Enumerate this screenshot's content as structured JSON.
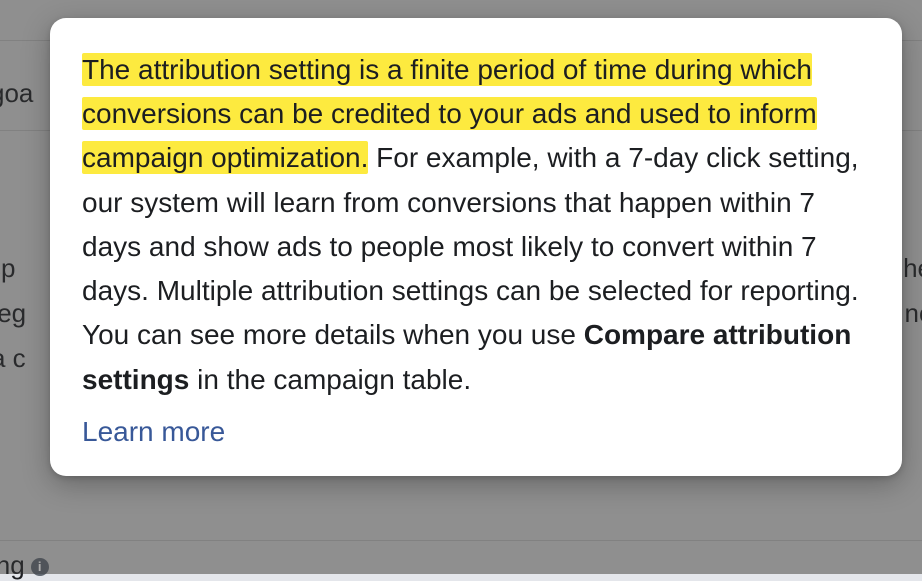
{
  "background": {
    "goa": "goa",
    "sp": " sp",
    "teg": "teg",
    "ac": "  a c",
    "ing": "ing",
    "he": "he",
    "nc": "nc"
  },
  "tooltip": {
    "highlighted_text": "The attribution setting is a finite period of time during which conversions can be credited to your ads and used to inform campaign optimization.",
    "body_text": " For example, with a 7-day click setting, our system will learn from conversions that happen within 7 days and show ads to people most likely to convert within 7 days. Multiple attribution settings can be selected for reporting. You can see more details when you use ",
    "bold_text": "Compare attribution settings",
    "body_tail": " in the campaign table.",
    "learn_more": "Learn more"
  }
}
